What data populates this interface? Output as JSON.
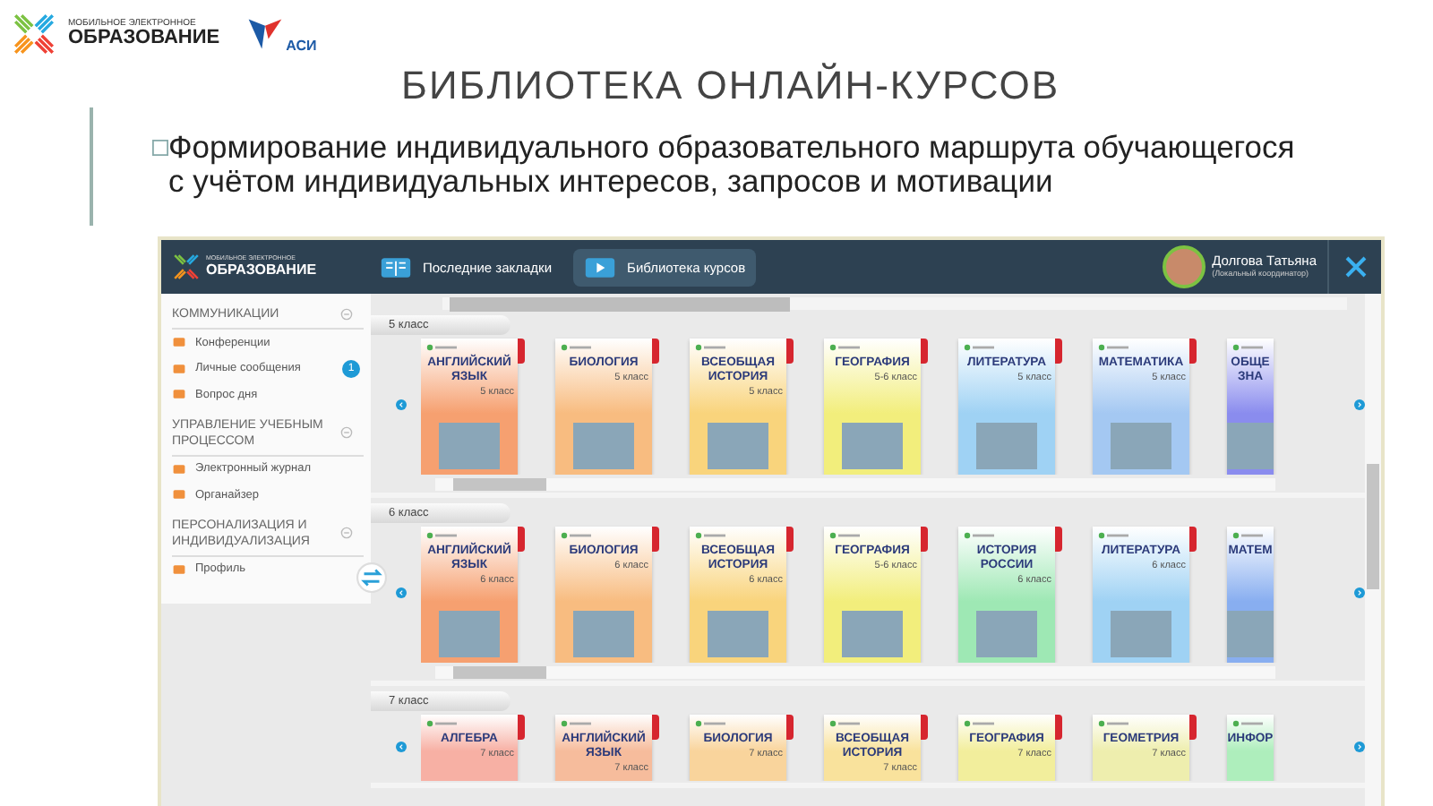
{
  "slide": {
    "logo": {
      "line1": "МОБИЛЬНОЕ ЭЛЕКТРОННОЕ",
      "line2": "ОБРАЗОВАНИЕ",
      "partner": "АСИ"
    },
    "title": "БИБЛИОТЕКА ОНЛАЙН-КУРСОВ",
    "bullet": "Формирование индивидуального образовательного маршрута  обучающегося с учётом индивидуальных интересов, запросов и мотивации"
  },
  "app": {
    "brand": {
      "line1": "МОБИЛЬНОЕ ЭЛЕКТРОННОЕ",
      "line2": "ОБРАЗОВАНИЕ"
    },
    "tabs": [
      {
        "label": "Последние закладки",
        "selected": false
      },
      {
        "label": "Библиотека курсов",
        "selected": true
      }
    ],
    "user": {
      "name": "Долгова Татьяна",
      "role": "(Локальный координатор)"
    },
    "sidebar": {
      "sections": [
        {
          "title": "КОММУНИКАЦИИ",
          "items": [
            {
              "label": "Конференции"
            },
            {
              "label": "Личные сообщения",
              "badge": "1"
            },
            {
              "label": "Вопрос дня"
            }
          ]
        },
        {
          "title": "УПРАВЛЕНИЕ УЧЕБНЫМ ПРОЦЕССОМ",
          "items": [
            {
              "label": "Электронный журнал"
            },
            {
              "label": "Органайзер"
            }
          ]
        },
        {
          "title": "ПЕРСОНАЛИЗАЦИЯ И ИНДИВИДУАЛИЗАЦИЯ",
          "items": [
            {
              "label": "Профиль"
            }
          ]
        }
      ]
    },
    "shelves": [
      {
        "label": "5 класс",
        "scrollbar": true,
        "books": [
          {
            "title": "АНГЛИЙСКИЙ ЯЗЫК",
            "grade": "5 класс",
            "color": "#f6a070",
            "picture": true,
            "partial": false
          },
          {
            "title": "БИОЛОГИЯ",
            "grade": "5 класс",
            "color": "#f8bc80",
            "picture": true,
            "partial": false
          },
          {
            "title": "ВСЕОБЩАЯ ИСТОРИЯ",
            "grade": "5 класс",
            "color": "#f9d47c",
            "picture": true,
            "partial": false
          },
          {
            "title": "ГЕОГРАФИЯ",
            "grade": "5-6 класс",
            "color": "#f2ee7c",
            "picture": true,
            "partial": false
          },
          {
            "title": "ЛИТЕРАТУРА",
            "grade": "5 класс",
            "color": "#9fd2f4",
            "picture": true,
            "partial": false
          },
          {
            "title": "МАТЕМАТИКА",
            "grade": "5 класс",
            "color": "#a4c8f2",
            "picture": true,
            "partial": false
          },
          {
            "title": "ОБЩЕ ЗНА",
            "color": "#8a8cee",
            "picture": true,
            "partial": true
          }
        ]
      },
      {
        "label": "6 класс",
        "scrollbar": true,
        "books": [
          {
            "title": "АНГЛИЙСКИЙ ЯЗЫК",
            "grade": "6 класс",
            "color": "#f6a070",
            "picture": true,
            "partial": false
          },
          {
            "title": "БИОЛОГИЯ",
            "grade": "6 класс",
            "color": "#f8bc80",
            "picture": true,
            "partial": false
          },
          {
            "title": "ВСЕОБЩАЯ ИСТОРИЯ",
            "grade": "6 класс",
            "color": "#f9d47c",
            "picture": true,
            "partial": false
          },
          {
            "title": "ГЕОГРАФИЯ",
            "grade": "5-6 класс",
            "color": "#f2ee7c",
            "picture": true,
            "partial": false
          },
          {
            "title": "ИСТОРИЯ РОССИИ",
            "grade": "6 класс",
            "color": "#9ee8b4",
            "picture": true,
            "partial": false
          },
          {
            "title": "ЛИТЕРАТУРА",
            "grade": "6 класс",
            "color": "#9fd2f4",
            "picture": true,
            "partial": false
          },
          {
            "title": "МАТЕМ",
            "color": "#88aef0",
            "picture": true,
            "partial": true
          }
        ]
      },
      {
        "label": "7 класс",
        "scrollbar": false,
        "books": [
          {
            "title": "АЛГЕБРА",
            "grade": "7 класс",
            "color": "#f7b0a4",
            "picture": false,
            "partial": false
          },
          {
            "title": "АНГЛИЙСКИЙ ЯЗЫК",
            "grade": "7 класс",
            "color": "#f6bc9c",
            "picture": false,
            "partial": false
          },
          {
            "title": "БИОЛОГИЯ",
            "grade": "7 класс",
            "color": "#f9d49c",
            "picture": false,
            "partial": false
          },
          {
            "title": "ВСЕОБЩАЯ ИСТОРИЯ",
            "grade": "7 класс",
            "color": "#f9e29c",
            "picture": false,
            "partial": false
          },
          {
            "title": "ГЕОГРАФИЯ",
            "grade": "7 класс",
            "color": "#f2ee9c",
            "picture": false,
            "partial": false
          },
          {
            "title": "ГЕОМЕТРИЯ",
            "grade": "7 класс",
            "color": "#eeeeae",
            "picture": false,
            "partial": false
          },
          {
            "title": "ИНФОР",
            "color": "#aeeebc",
            "picture": false,
            "partial": true
          }
        ]
      }
    ]
  }
}
